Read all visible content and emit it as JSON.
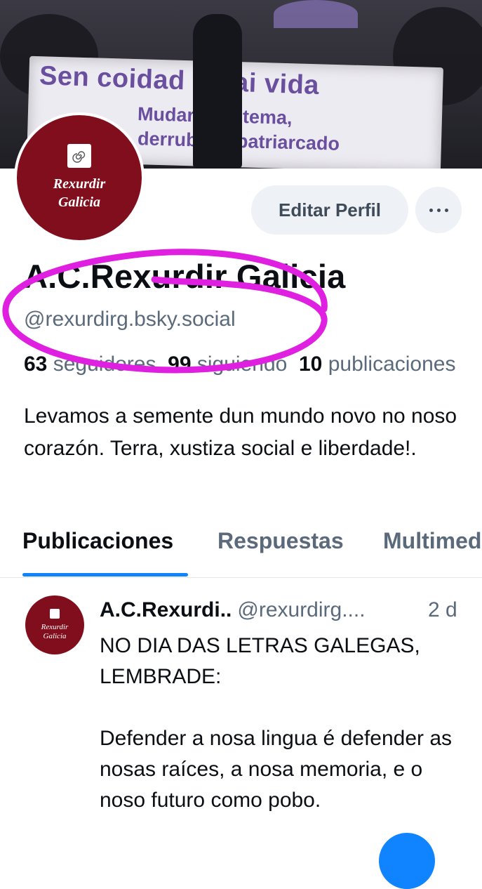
{
  "banner": {
    "line1": "Sen coidad    n hai vida",
    "line2": "Mudar   o sistema,",
    "line3": "derrub    o o patriarcado"
  },
  "avatar": {
    "line1": "Rexurdir",
    "line2": "Galicia"
  },
  "actions": {
    "edit_profile": "Editar Perfil"
  },
  "profile": {
    "display_name": "A.C.Rexurdir Galicia",
    "handle": "@rexurdirg.bsky.social",
    "followers_count": "63",
    "followers_label": "seguidores",
    "following_count": "99",
    "following_label": "siguiendo",
    "posts_count": "10",
    "posts_label": "publicaciones",
    "bio": "Levamos a semente dun mundo novo no noso corazón. Terra, xustiza social e liberdade!."
  },
  "tabs": [
    {
      "label": "Publicaciones",
      "active": true
    },
    {
      "label": "Respuestas"
    },
    {
      "label": "Multimedia"
    }
  ],
  "post": {
    "author": "A.C.Rexurdi..",
    "handle": "@rexurdirg....",
    "time": "2 d",
    "avatar_line1": "Rexurdir",
    "avatar_line2": "Galicia",
    "body": "NO DIA DAS LETRAS GALEGAS, LEMBRADE:\n\nDefender a nosa lingua é defender as nosas raíces, a nosa memoria, e o noso futuro como pobo."
  },
  "colors": {
    "accent": "#1083fe",
    "annotation": "#e020e0",
    "avatar_bg": "#800e1c"
  }
}
